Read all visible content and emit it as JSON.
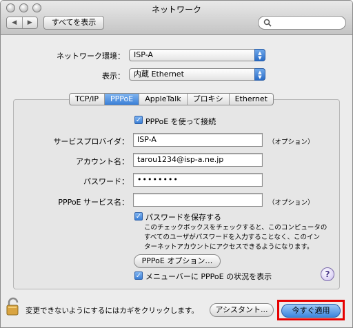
{
  "window": {
    "title": "ネットワーク",
    "nav_back": "◀",
    "nav_forward": "▶",
    "show_all_label": "すべてを表示",
    "search_placeholder": ""
  },
  "network": {
    "location_label": "ネットワーク環境：",
    "location_value": "ISP-A",
    "show_label": "表示：",
    "show_value": "内蔵 Ethernet"
  },
  "tabs": [
    {
      "label": "TCP/IP",
      "active": false
    },
    {
      "label": "PPPoE",
      "active": true
    },
    {
      "label": "AppleTalk",
      "active": false
    },
    {
      "label": "プロキシ",
      "active": false
    },
    {
      "label": "Ethernet",
      "active": false
    }
  ],
  "pppoe": {
    "connect_checkbox_label": "PPPoE を使って接続",
    "connect_checked": true,
    "provider_label": "サービスプロバイダ：",
    "provider_value": "ISP-A",
    "optional_1": "（オプション）",
    "account_label": "アカウント名：",
    "account_value": "tarou1234@isp-a.ne.jp",
    "password_label": "パスワード：",
    "password_value": "••••••••",
    "service_label": "PPPoE サービス名：",
    "service_value": "",
    "optional_2": "（オプション）",
    "save_password_label": "パスワードを保存する",
    "save_password_checked": true,
    "save_password_desc_1": "このチェックボックスをチェックすると、このコンピュータの",
    "save_password_desc_2": "すべてのユーザがパスワードを入力することなく、このイン",
    "save_password_desc_3": "ターネットアカウントにアクセスできるようになります。",
    "options_button": "PPPoE オプション…",
    "menubar_status_label": "メニューバーに PPPoE の状況を表示",
    "menubar_status_checked": true,
    "help_label": "?"
  },
  "footer": {
    "lock_text": "変更できないようにするにはカギをクリックします。",
    "assistant_button": "アシスタント...",
    "apply_button": "今すぐ適用"
  }
}
